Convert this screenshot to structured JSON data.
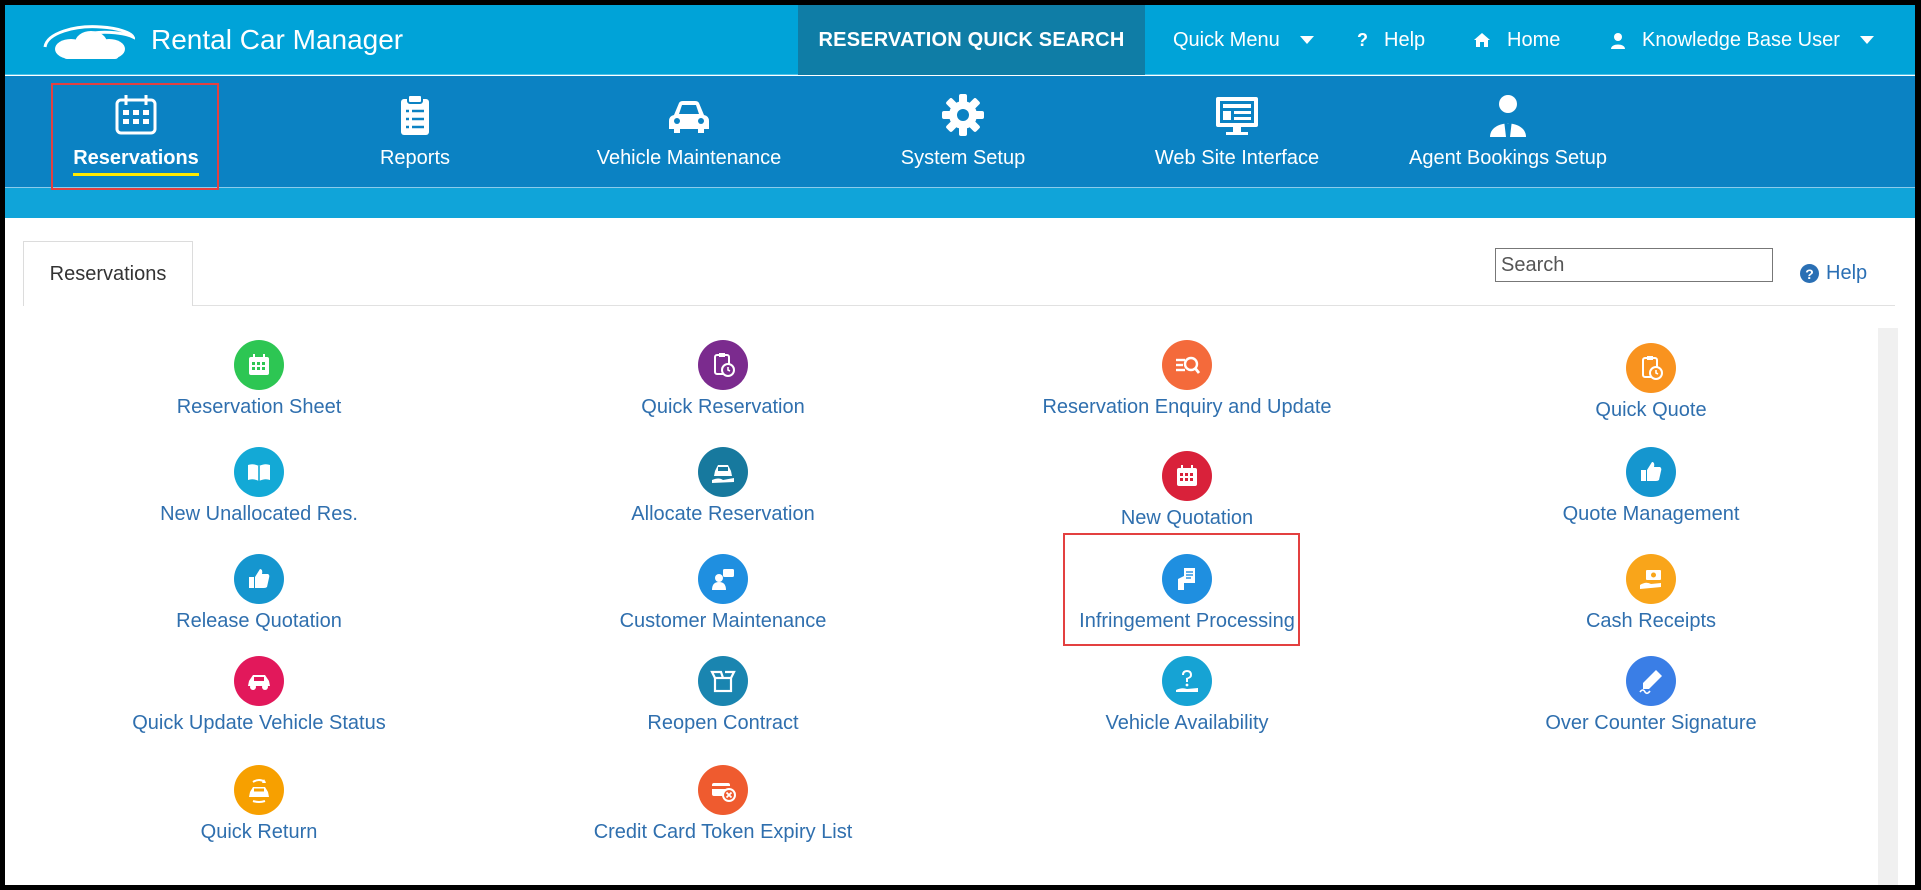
{
  "app": {
    "title": "Rental Car Manager",
    "quick_search": "RESERVATION QUICK SEARCH",
    "quick_menu": "Quick Menu",
    "help": "Help",
    "home": "Home",
    "user": "Knowledge Base User"
  },
  "modules": [
    {
      "label": "Reservations",
      "icon": "calendar-icon",
      "active": true
    },
    {
      "label": "Reports",
      "icon": "clipboard-list-icon"
    },
    {
      "label": "Vehicle Maintenance",
      "icon": "car-icon"
    },
    {
      "label": "System Setup",
      "icon": "gear-icon"
    },
    {
      "label": "Web Site Interface",
      "icon": "monitor-icon"
    },
    {
      "label": "Agent Bookings Setup",
      "icon": "agent-icon"
    }
  ],
  "tab": {
    "label": "Reservations"
  },
  "search": {
    "placeholder": "Search"
  },
  "help_link": "Help",
  "items": [
    {
      "label": "Reservation Sheet",
      "color": "#2dc653",
      "icon": "calendar-icon"
    },
    {
      "label": "Quick Reservation",
      "color": "#7b2b8e",
      "icon": "clipboard-clock-icon"
    },
    {
      "label": "Reservation Enquiry and Update",
      "color": "#f46a3b",
      "icon": "list-search-icon"
    },
    {
      "label": "Quick Quote",
      "color": "#f9931f",
      "icon": "clipboard-clock-icon"
    },
    {
      "label": "New Unallocated Res.",
      "color": "#13a9d6",
      "icon": "open-book-icon"
    },
    {
      "label": "Allocate Reservation",
      "color": "#17799e",
      "icon": "car-hand-icon"
    },
    {
      "label": "New Quotation",
      "color": "#d9213a",
      "icon": "calendar-icon"
    },
    {
      "label": "Quote Management",
      "color": "#1596cf",
      "icon": "thumbs-up-icon"
    },
    {
      "label": "Release Quotation",
      "color": "#1596cf",
      "icon": "thumbs-up-icon"
    },
    {
      "label": "Customer Maintenance",
      "color": "#1f8fe0",
      "icon": "person-chat-icon"
    },
    {
      "label": "Infringement Processing",
      "color": "#1f8fe0",
      "icon": "hand-document-icon"
    },
    {
      "label": "Cash Receipts",
      "color": "#f9a51a",
      "icon": "hand-money-icon"
    },
    {
      "label": "Quick Update Vehicle Status",
      "color": "#e2185b",
      "icon": "car-icon"
    },
    {
      "label": "Reopen Contract",
      "color": "#1a85b0",
      "icon": "open-box-icon"
    },
    {
      "label": "Vehicle Availability",
      "color": "#16a3d4",
      "icon": "question-hand-icon"
    },
    {
      "label": "Over Counter Signature",
      "color": "#3a7ee6",
      "icon": "signature-pen-icon"
    },
    {
      "label": "Quick Return",
      "color": "#f7a000",
      "icon": "car-return-icon"
    },
    {
      "label": "Credit Card Token Expiry List",
      "color": "#ef5b2f",
      "icon": "card-cancel-icon"
    }
  ]
}
